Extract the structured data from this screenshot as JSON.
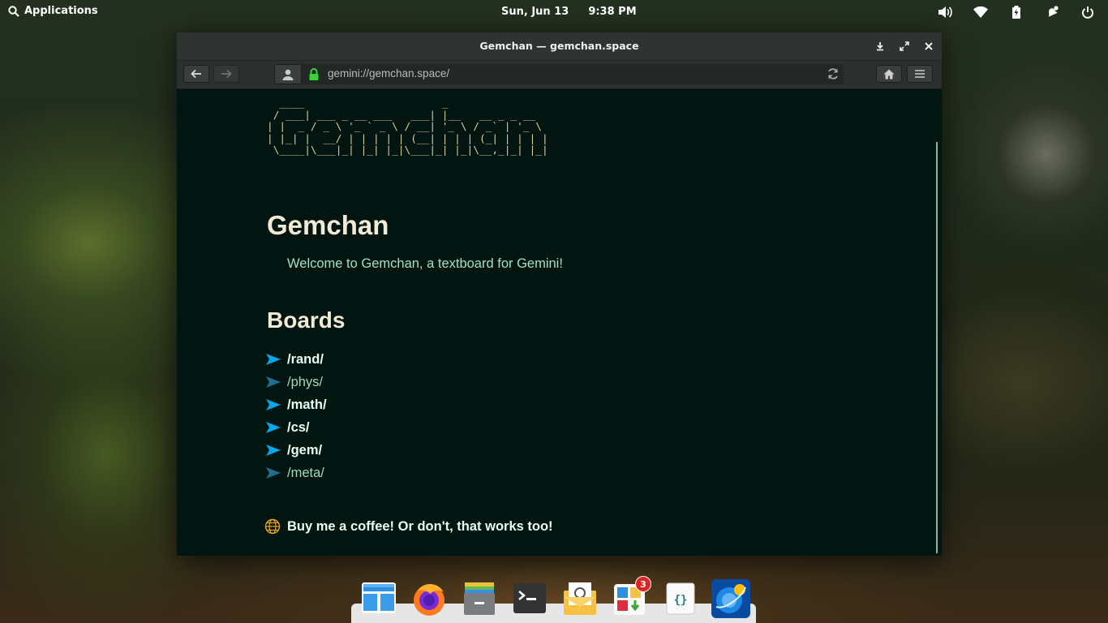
{
  "topbar": {
    "applications_label": "Applications",
    "date": "Sun, Jun 13",
    "time": "9:38 PM"
  },
  "window": {
    "title": "Gemchan — gemchan.space",
    "url": "gemini://gemchan.space/"
  },
  "page": {
    "ascii_art": "  ____                      _\n / ___| ___ _ __ ___   ___| |__   __ _ _ __\n| |  _ / _ \\ '_ ` _ \\ / __| '_ \\ / _` | '_ \\\n| |_| |  __/ | | | | | (__| | | | (_| | | | |\n \\____|\\___|_| |_| |_|\\___|_| |_|\\__,_|_| |_|",
    "heading": "Gemchan",
    "welcome": "Welcome to Gemchan, a textboard for Gemini!",
    "boards_heading": "Boards",
    "boards": [
      {
        "label": "/rand/",
        "style": "bold"
      },
      {
        "label": "/phys/",
        "style": "dim"
      },
      {
        "label": "/math/",
        "style": "bold"
      },
      {
        "label": "/cs/",
        "style": "bold"
      },
      {
        "label": "/gem/",
        "style": "bold"
      },
      {
        "label": "/meta/",
        "style": "dim"
      }
    ],
    "coffee_link": "Buy me a coffee! Or don't, that works too!"
  },
  "dock": {
    "badge_count": "3"
  },
  "colors": {
    "page_bg": "#021510",
    "link_arrow": "#00a8e8",
    "heading": "#f1ead7",
    "text": "#9fe0c7"
  }
}
